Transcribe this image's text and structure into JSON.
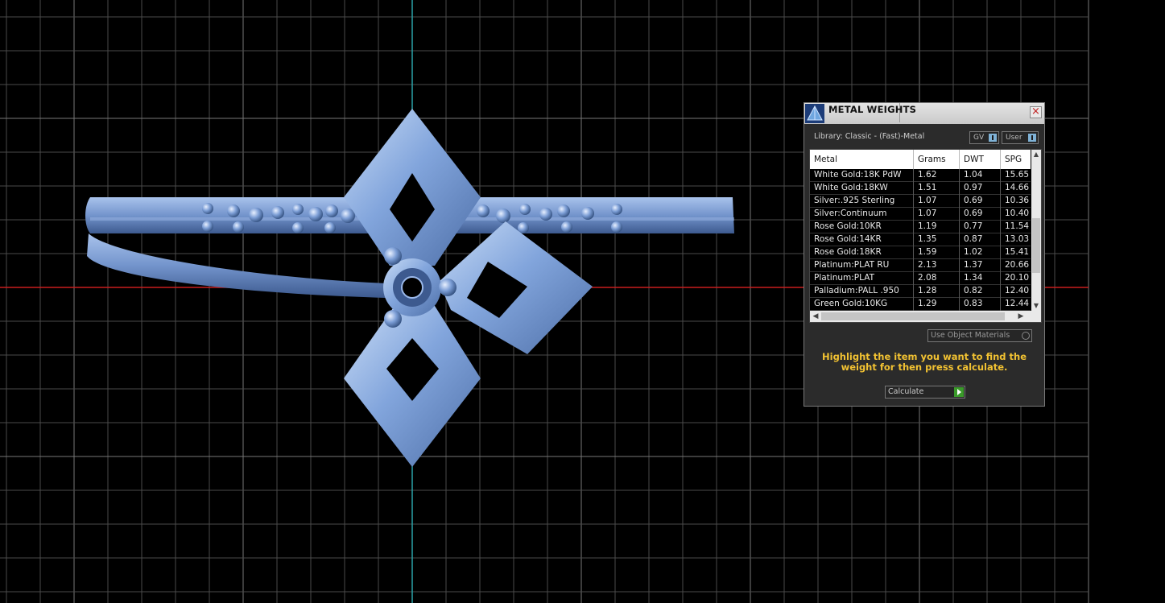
{
  "dialog": {
    "title": "METAL WEIGHTS",
    "close_glyph": "×",
    "library_label": "Library: Classic - (Fast)-Metal",
    "gv_label": "GV",
    "user_label": "User",
    "columns": [
      "Metal",
      "Grams",
      "DWT",
      "SPG"
    ],
    "rows": [
      {
        "metal": "White Gold:18K PdW",
        "grams": "1.62",
        "dwt": "1.04",
        "spg": "15.65"
      },
      {
        "metal": "White Gold:18KW",
        "grams": "1.51",
        "dwt": "0.97",
        "spg": "14.66"
      },
      {
        "metal": "Silver:.925 Sterling",
        "grams": "1.07",
        "dwt": "0.69",
        "spg": "10.36"
      },
      {
        "metal": "Silver:Continuum",
        "grams": "1.07",
        "dwt": "0.69",
        "spg": "10.40"
      },
      {
        "metal": "Rose Gold:10KR",
        "grams": "1.19",
        "dwt": "0.77",
        "spg": "11.54"
      },
      {
        "metal": "Rose Gold:14KR",
        "grams": "1.35",
        "dwt": "0.87",
        "spg": "13.03"
      },
      {
        "metal": "Rose Gold:18KR",
        "grams": "1.59",
        "dwt": "1.02",
        "spg": "15.41"
      },
      {
        "metal": "Platinum:PLAT RU",
        "grams": "2.13",
        "dwt": "1.37",
        "spg": "20.66"
      },
      {
        "metal": "Platinum:PLAT",
        "grams": "2.08",
        "dwt": "1.34",
        "spg": "20.10"
      },
      {
        "metal": "Palladium:PALL .950",
        "grams": "1.28",
        "dwt": "0.82",
        "spg": "12.40"
      },
      {
        "metal": "Green Gold:10KG",
        "grams": "1.29",
        "dwt": "0.83",
        "spg": "12.44"
      }
    ],
    "use_object_materials_label": "Use Object Materials",
    "hint_text": "Highlight the item you want to find the weight for then press calculate.",
    "calculate_label": "Calculate"
  },
  "colors": {
    "viewport_bg": "#000000",
    "grid": "#5a5a5a",
    "axis_x": "#c81e1e",
    "axis_y": "#2aa3a8",
    "model": "#7fa2da",
    "hint": "#f2c232"
  },
  "icons": {
    "dialog_logo": "app-logo-icon",
    "close": "close-icon",
    "toggle": "info-toggle-icon",
    "calculate": "play-arrow-icon"
  }
}
